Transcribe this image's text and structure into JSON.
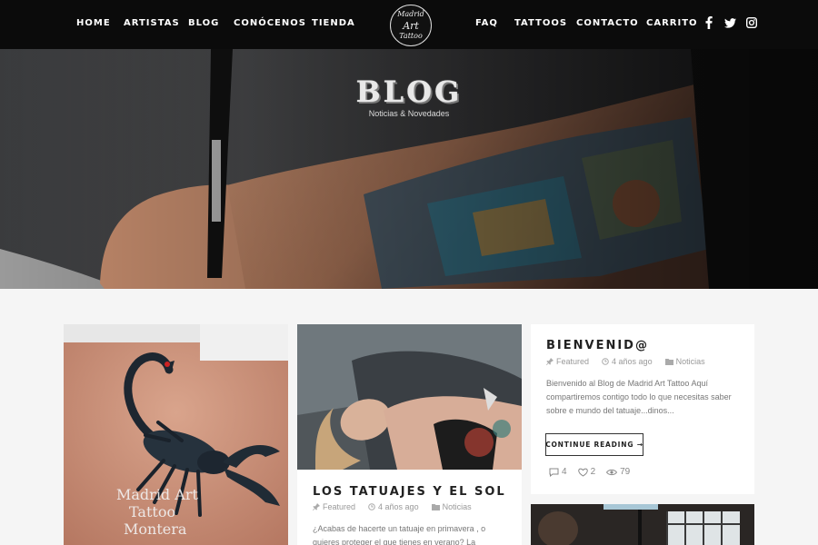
{
  "nav": {
    "left": [
      "HOME",
      "ARTISTAS",
      "BLOG",
      "CONÓCENOS",
      "TIENDA"
    ],
    "right": [
      "FAQ",
      "TATTOOS",
      "CONTACTO",
      "CARRITO"
    ],
    "logo_lines": [
      "Madrid",
      "Art",
      "Tattoo"
    ],
    "social": [
      "facebook-icon",
      "twitter-icon",
      "instagram-icon"
    ]
  },
  "hero": {
    "title": "BLOG",
    "subtitle": "Noticias & Novedades"
  },
  "cards": {
    "scorpion": {
      "overlay_lines": [
        "Madrid Art",
        "Tattoo",
        "Montera"
      ]
    },
    "sol": {
      "title": "LOS TATUAJES Y EL SOL",
      "category": "Featured",
      "date": "4 años ago",
      "tag": "Noticias",
      "excerpt": "¿Acabas de hacerte un tatuaje en primavera , o quieres proteger el que tienes en verano? La"
    },
    "bienvenida": {
      "title": "BIENVENID@",
      "category": "Featured",
      "date": "4 años ago",
      "tag": "Noticias",
      "excerpt": "Bienvenido al Blog de Madrid Art Tattoo Aquí compartiremos contigo todo lo que necesitas saber sobre e mundo del tatuaje...dinos...",
      "button": "CONTINUE READING →",
      "comments": "4",
      "likes": "2",
      "views": "79"
    }
  },
  "colors": {
    "nav_bg": "#0b0b0b",
    "page_bg": "#f5f5f5",
    "text_dark": "#222222",
    "text_muted": "#999999"
  }
}
